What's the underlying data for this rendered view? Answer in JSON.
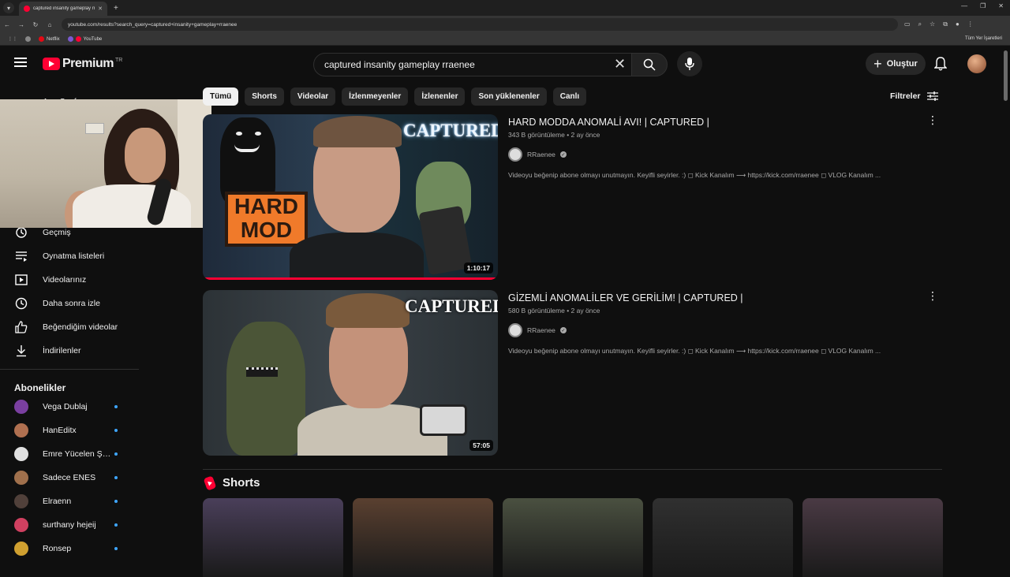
{
  "browser": {
    "tab_title": "captured insanity gameplay rra...",
    "url": "youtube.com/results?search_query=captured+insanity+gameplay+rraenee",
    "bookmarks": [
      {
        "label": "Netflix",
        "color": "#e50914"
      },
      {
        "label": "YouTube",
        "color": "#ff0033"
      }
    ],
    "bookmarks_right": "Tüm Yer İşaretleri"
  },
  "header": {
    "logo_text": "Premium",
    "logo_country": "TR",
    "search_value": "captured insanity gameplay rraenee",
    "create_label": "Oluştur"
  },
  "sidebar": {
    "partial_top_label": "Ana Sayfa",
    "items": [
      {
        "label": "Geçmiş",
        "icon": "history-icon"
      },
      {
        "label": "Oynatma listeleri",
        "icon": "playlist-icon"
      },
      {
        "label": "Videolarınız",
        "icon": "your-videos-icon"
      },
      {
        "label": "Daha sonra izle",
        "icon": "watch-later-icon"
      },
      {
        "label": "Beğendiğim videolar",
        "icon": "liked-icon"
      },
      {
        "label": "İndirilenler",
        "icon": "download-icon"
      }
    ],
    "subs_heading": "Abonelikler",
    "subscriptions": [
      {
        "label": "Vega Dublaj",
        "color": "#7a3fa0"
      },
      {
        "label": "HanEditx",
        "color": "#b07050"
      },
      {
        "label": "Emre Yücelen Şa...",
        "color": "#e0e0e0"
      },
      {
        "label": "Sadece ENES",
        "color": "#a0704c"
      },
      {
        "label": "Elraenn",
        "color": "#50403a"
      },
      {
        "label": "surthany hejeij",
        "color": "#d04060"
      },
      {
        "label": "Ronsep",
        "color": "#d0a030"
      }
    ]
  },
  "chips": [
    {
      "label": "Tümü",
      "active": true
    },
    {
      "label": "Shorts",
      "active": false
    },
    {
      "label": "Videolar",
      "active": false
    },
    {
      "label": "İzlenmeyenler",
      "active": false
    },
    {
      "label": "İzlenenler",
      "active": false
    },
    {
      "label": "Son yüklenenler",
      "active": false
    },
    {
      "label": "Canlı",
      "active": false
    }
  ],
  "filters_label": "Filtreler",
  "results": [
    {
      "title": "HARD MODDA ANOMALİ AVI! | CAPTURED |",
      "meta": "343 B görüntüleme • 2 ay önce",
      "channel": "RRaenee",
      "description": "Videoyu beğenip abone olmayı unutmayın. Keyifli seyirler. :) ◻ Kick Kanalım ⟶ https://kick.com/rraenee ◻ VLOG Kanalım ...",
      "duration": "1:10:17",
      "thumb_caption": "CAPTURED",
      "thumb_sign": "HARD MOD",
      "watched_fraction": 1.0
    },
    {
      "title": "GİZEMLİ ANOMALİLER VE GERİLİM! | CAPTURED |",
      "meta": "580 B görüntüleme • 2 ay önce",
      "channel": "RRaenee",
      "description": "Videoyu beğenip abone olmayı unutmayın. Keyifli seyirler. :) ◻ Kick Kanalım ⟶ https://kick.com/rraenee ◻ VLOG Kanalım ...",
      "duration": "57:05",
      "thumb_caption": "CAPTURED"
    }
  ],
  "shorts_heading": "Shorts",
  "shorts_colors": [
    "#4a3f5a",
    "#5a4030",
    "#4a5040",
    "#303030",
    "#4a3a44"
  ],
  "colors": {
    "background": "#0f0f0f",
    "accent": "#ff0033",
    "chip": "#272727",
    "text_secondary": "#aaaaaa",
    "new_dot": "#3ea6ff"
  }
}
